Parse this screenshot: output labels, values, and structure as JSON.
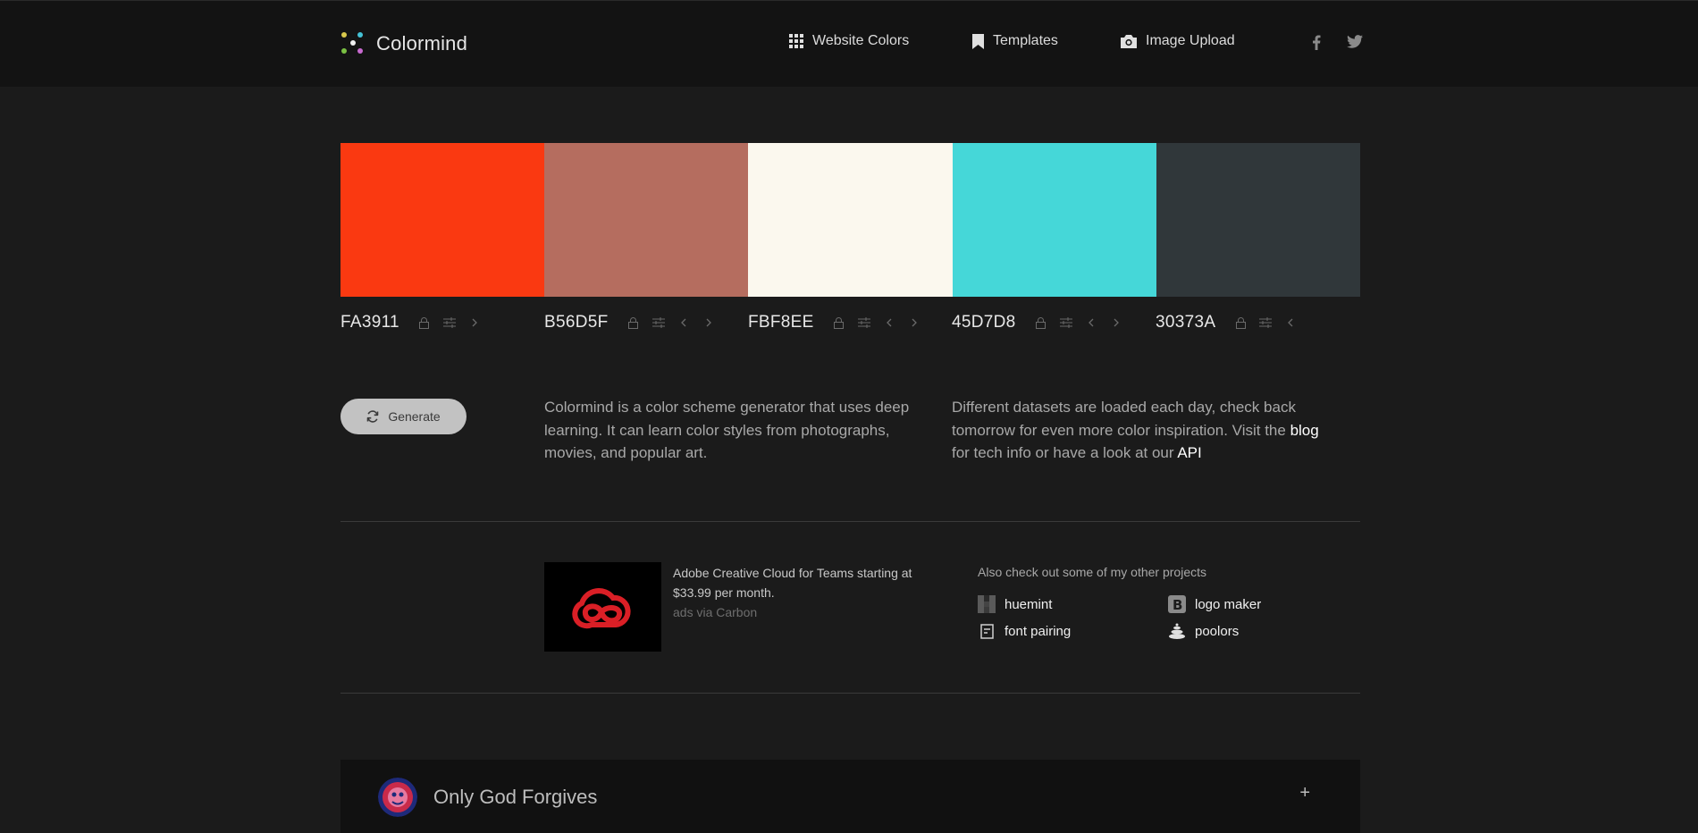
{
  "header": {
    "logo_text": "Colormind",
    "nav": [
      {
        "label": "Website Colors",
        "icon": "grid-icon"
      },
      {
        "label": "Templates",
        "icon": "bookmark-icon"
      },
      {
        "label": "Image Upload",
        "icon": "camera-icon"
      }
    ],
    "social": [
      "facebook-icon",
      "twitter-icon"
    ]
  },
  "palette": {
    "colors": [
      {
        "hex": "FA3911",
        "color": "#FA3911"
      },
      {
        "hex": "B56D5F",
        "color": "#B56D5F"
      },
      {
        "hex": "FBF8EE",
        "color": "#FBF8EE"
      },
      {
        "hex": "45D7D8",
        "color": "#45D7D8"
      },
      {
        "hex": "30373A",
        "color": "#30373A"
      }
    ]
  },
  "generate": {
    "label": "Generate",
    "icon": "refresh-icon"
  },
  "intro": {
    "text": "Colormind is a color scheme generator that uses deep learning. It can learn color styles from photographs, movies, and popular art."
  },
  "datasets": {
    "text_before": "Different datasets are loaded each day, check back tomorrow for even more color inspiration. Visit the ",
    "blog_link": "blog",
    "text_middle": " for tech info or have a look at our ",
    "api_link": "API"
  },
  "ad": {
    "text": "Adobe Creative Cloud for Teams starting at $33.99 per month.",
    "via": "ads via Carbon",
    "brand_color": "#DA1F26"
  },
  "projects": {
    "title": "Also check out some of my other projects",
    "items": [
      {
        "label": "huemint",
        "icon": "huemint-icon"
      },
      {
        "label": "logo maker",
        "icon": "logo-maker-icon"
      },
      {
        "label": "font pairing",
        "icon": "font-pairing-icon"
      },
      {
        "label": "poolors",
        "icon": "poolors-icon"
      }
    ]
  },
  "dataset_panel": {
    "title": "Only God Forgives",
    "expand": "+"
  }
}
